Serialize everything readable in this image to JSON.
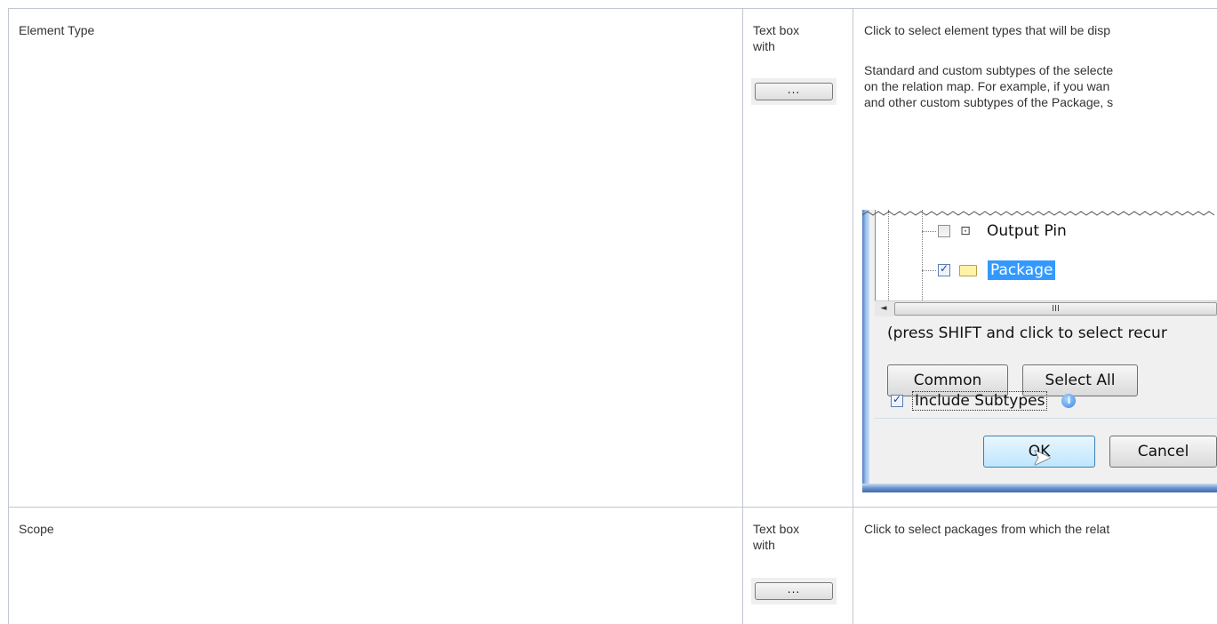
{
  "rows": [
    {
      "property": "Element Type",
      "value_type_line1": "Text box",
      "value_type_line2": "with",
      "button_label": "...",
      "description_p1": "Click to select element types that will be disp",
      "description_p2_lines": [
        "Standard and custom subtypes of the selecte",
        "on the relation map. For example, if you wan",
        "and other custom subtypes of the Package, s"
      ]
    },
    {
      "property": "Scope",
      "value_type_line1": "Text box",
      "value_type_line2": "with",
      "button_label": "...",
      "description_p1": "Click to select packages from which the relat"
    }
  ],
  "dialog": {
    "tree_items": [
      {
        "label": "Output Pin",
        "checked": false,
        "selected": false,
        "icon": "output-pin-icon"
      },
      {
        "label": "Package",
        "checked": true,
        "selected": true,
        "icon": "folder-icon"
      }
    ],
    "scroll_left": "◄",
    "scroll_grip": "III",
    "hint": "(press SHIFT and click to select recur",
    "common_label": "Common",
    "select_all_label": "Select All",
    "include_subtypes_label": "Include Subtypes",
    "include_subtypes_checked": true,
    "ok_label": "OK",
    "cancel_label": "Cancel"
  },
  "colors": {
    "border": "#c1c7d0",
    "selection": "#3399ff",
    "window_frame": "#4f7cc0"
  }
}
